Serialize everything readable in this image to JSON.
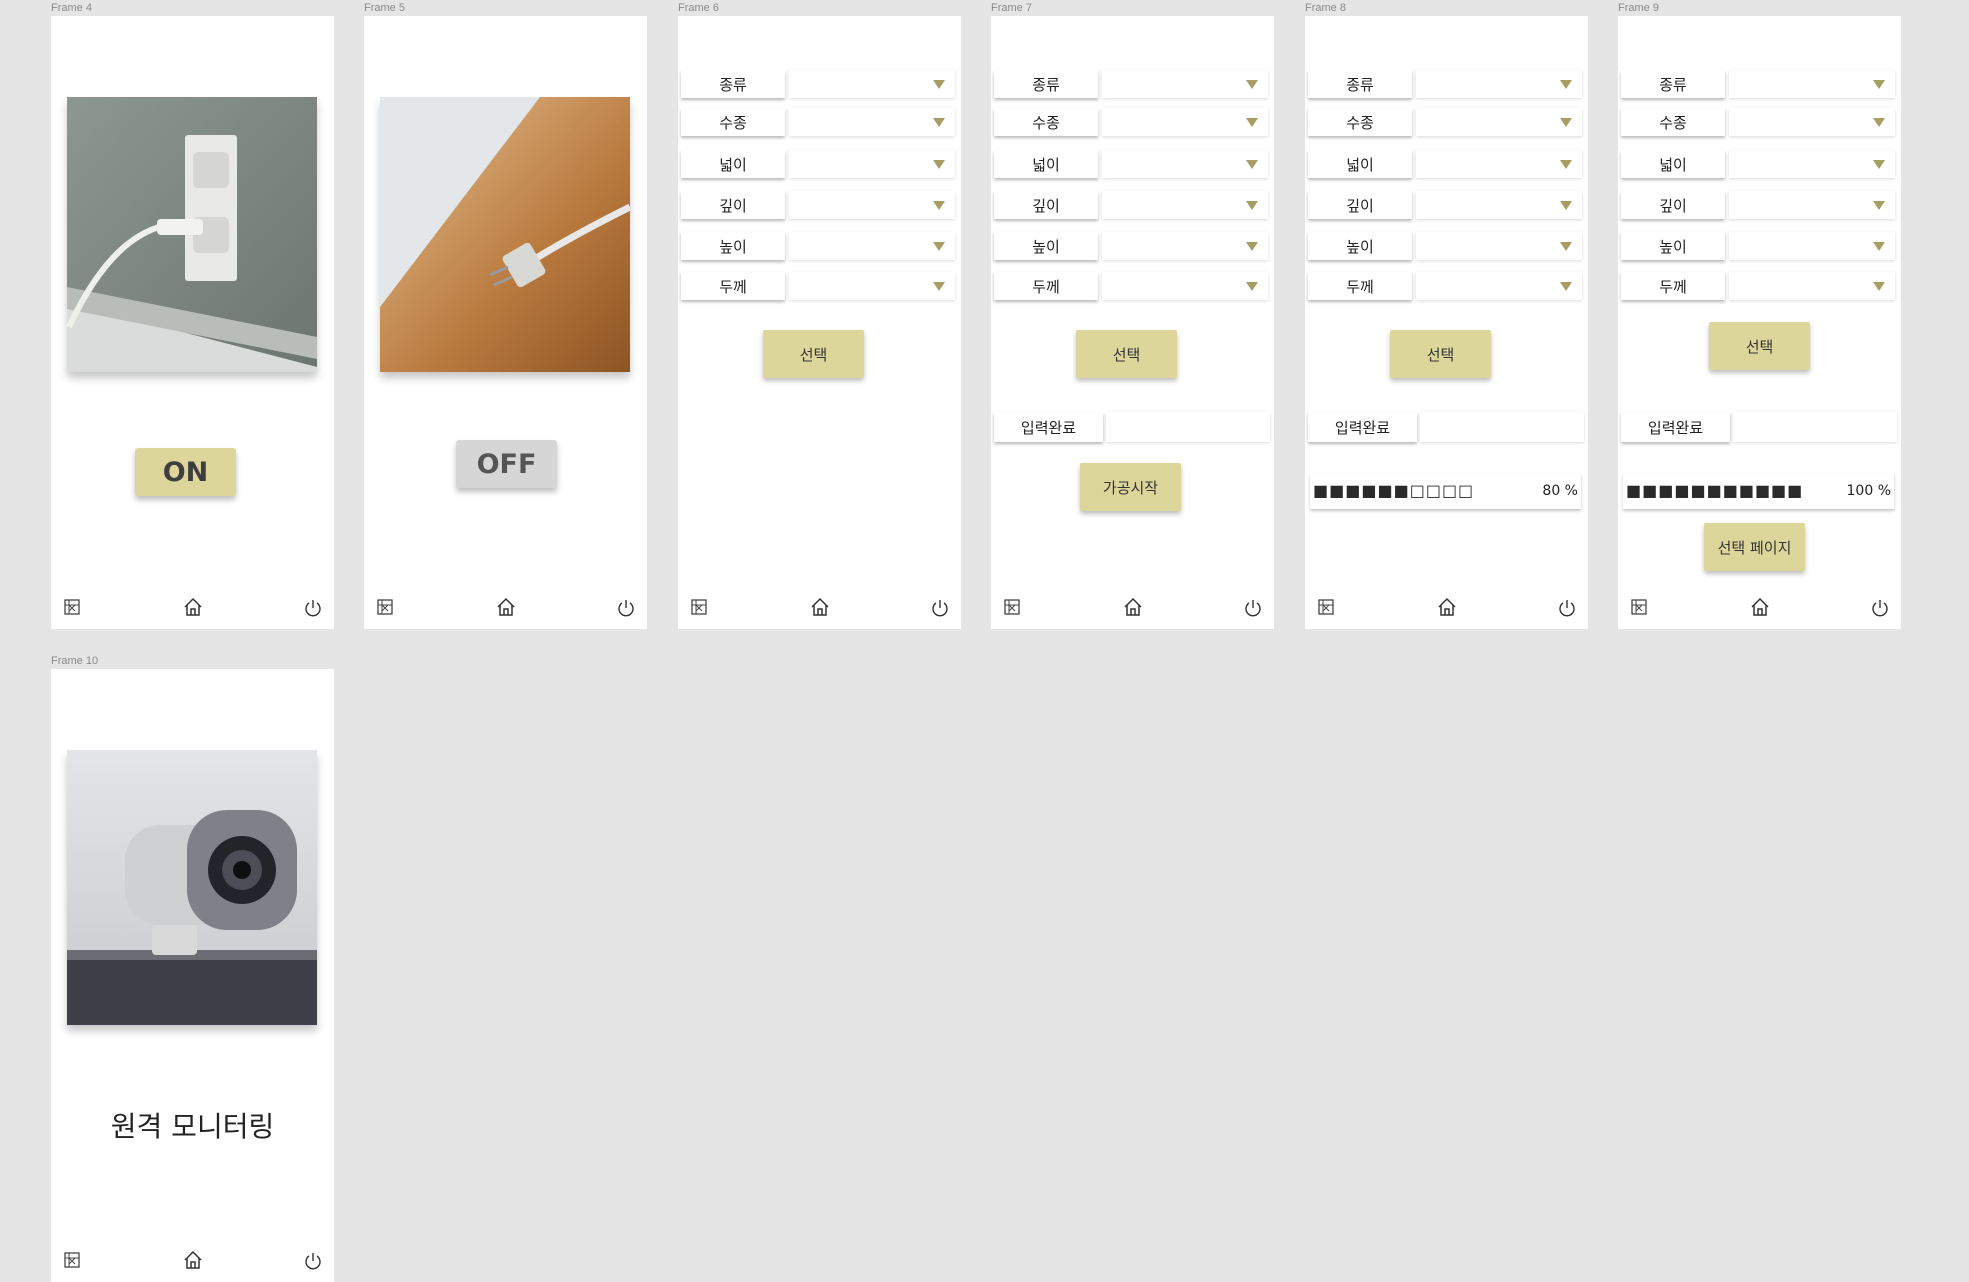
{
  "frames": {
    "f4": {
      "label": "Frame 4",
      "button": "ON",
      "image": "plug-in-outlet-photo"
    },
    "f5": {
      "label": "Frame 5",
      "button": "OFF",
      "image": "unplugged-plug-photo"
    },
    "f6": {
      "label": "Frame 6"
    },
    "f7": {
      "label": "Frame 7"
    },
    "f8": {
      "label": "Frame 8"
    },
    "f9": {
      "label": "Frame 9"
    },
    "f10": {
      "label": "Frame 10",
      "title": "원격 모니터링",
      "image": "webcam-photo"
    }
  },
  "form": {
    "rows": [
      "종류",
      "수종",
      "넓이",
      "깊이",
      "높이",
      "두께"
    ],
    "select_label": "선택",
    "done_label": "입력완료",
    "start_label": "가공시작",
    "back_label": "선택 페이지"
  },
  "progress": {
    "f8": {
      "cells": "■■■■■■□□□□",
      "text": "80 %",
      "value": 0.8
    },
    "f9": {
      "cells": "■■■■■■■■■■■",
      "text": "100 %",
      "value": 1.0
    }
  },
  "nav_icons": [
    "frame-grid-icon",
    "home-icon",
    "power-icon"
  ],
  "colors": {
    "accent": "#ddd69b",
    "dropdown_triangle": "#a79e64",
    "canvas": "#e5e5e5"
  }
}
